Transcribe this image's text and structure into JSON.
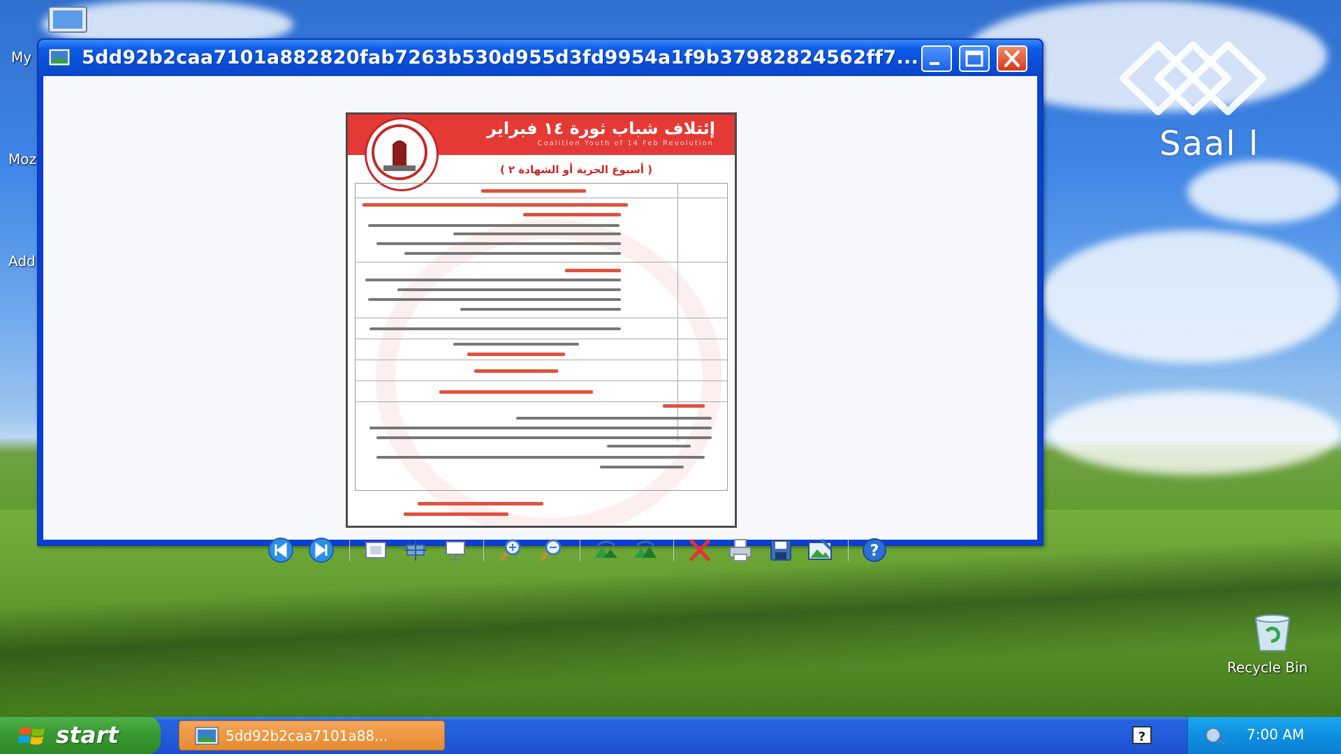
{
  "desktop": {
    "icons": [
      {
        "label": "My",
        "icon": "my-computer-icon"
      },
      {
        "label": "Moz",
        "icon": "firefox-icon"
      },
      {
        "label": "Add",
        "icon": "add-icon"
      }
    ],
    "recycle_bin": {
      "label": "Recycle Bin",
      "icon": "recycle-bin-icon"
    },
    "watermark": {
      "text": "Saal l"
    }
  },
  "window": {
    "title": "5dd92b2caa7101a882820fab7263b530d955d3fd9954a1f9b37982824562ff7...",
    "icon": "picture-viewer-icon",
    "controls": [
      "minimize",
      "maximize",
      "close"
    ]
  },
  "image": {
    "poster_title": "إئتلاف شباب ثورة ١٤ فبراير",
    "poster_subtitle": "Coalition Youth of 14 Feb Revolution",
    "poster_heading": "( أسبوع الحرية أو الشهادة ٢ )"
  },
  "toolbar": {
    "buttons": [
      {
        "name": "previous-image-button",
        "icon": "previous-icon"
      },
      {
        "name": "next-image-button",
        "icon": "next-icon"
      },
      {
        "name": "best-fit-button",
        "icon": "best-fit-icon"
      },
      {
        "name": "actual-size-button",
        "icon": "actual-size-icon"
      },
      {
        "name": "slideshow-button",
        "icon": "slideshow-icon"
      },
      {
        "name": "zoom-in-button",
        "icon": "zoom-in-icon"
      },
      {
        "name": "zoom-out-button",
        "icon": "zoom-out-icon"
      },
      {
        "name": "rotate-clockwise-button",
        "icon": "rotate-clockwise-icon"
      },
      {
        "name": "rotate-counterclockwise-button",
        "icon": "rotate-counterclockwise-icon"
      },
      {
        "name": "delete-button",
        "icon": "delete-icon"
      },
      {
        "name": "print-button",
        "icon": "print-icon"
      },
      {
        "name": "save-button",
        "icon": "save-icon"
      },
      {
        "name": "open-for-editing-button",
        "icon": "edit-icon"
      },
      {
        "name": "help-button",
        "icon": "help-icon"
      }
    ]
  },
  "taskbar": {
    "start_label": "start",
    "task_label": "5dd92b2caa7101a88...",
    "clock": "7:00 AM"
  },
  "colors": {
    "titlebar": "#0a4fd8",
    "start_button": "#3a9a33",
    "active_task": "#e58a2e",
    "close_button": "#d6391b"
  }
}
